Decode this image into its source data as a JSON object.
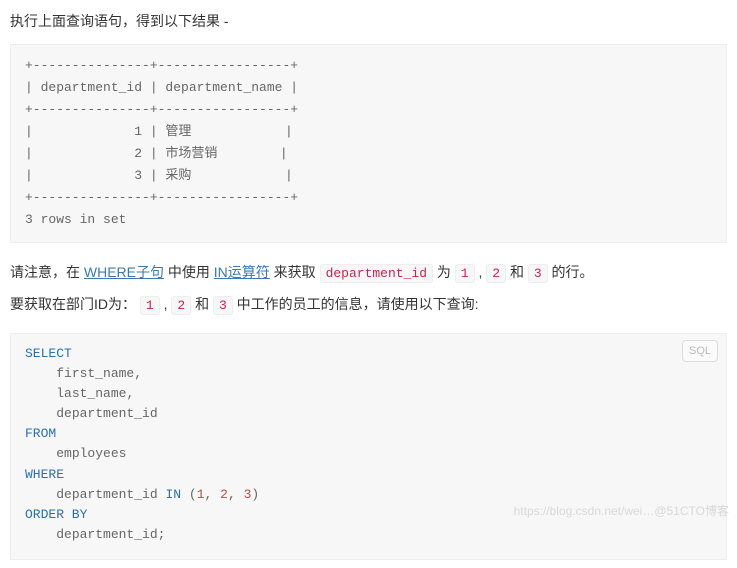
{
  "intro": "执行上面查询语句，得到以下结果 -",
  "result_block": "+---------------+-----------------+\n| department_id | department_name |\n+---------------+-----------------+\n|             1 | 管理            |\n|             2 | 市场营销        |\n|             3 | 采购            |\n+---------------+-----------------+\n3 rows in set",
  "note": {
    "p1": "请注意，在 ",
    "link_where": "WHERE子句",
    "p2": " 中使用 ",
    "link_in": "IN运算符",
    "p3": " 来获取 ",
    "code_dept": "department_id",
    "p4": " 为 ",
    "v1": "1",
    "p5": " , ",
    "v2": "2",
    "p6": " 和 ",
    "v3": "3",
    "p7": " 的行。"
  },
  "task": {
    "t1": "要获取在部门ID为： ",
    "v1": "1",
    "t2": " , ",
    "v2": "2",
    "t3": " 和 ",
    "v3": "3",
    "t4": " 中工作的员工的信息，请使用以下查询:"
  },
  "sql_badge": "SQL",
  "sql": {
    "kw_select": "SELECT",
    "f1": "first_name",
    "f2": "last_name",
    "f3": "department_id",
    "kw_from": "FROM",
    "tbl": "employees",
    "kw_where": "WHERE",
    "col": "department_id",
    "kw_in": "IN",
    "n1": "1",
    "n2": "2",
    "n3": "3",
    "kw_order": "ORDER BY",
    "ord_col": "department_id"
  },
  "watermark": "https://blog.csdn.net/wei…@51CTO博客"
}
